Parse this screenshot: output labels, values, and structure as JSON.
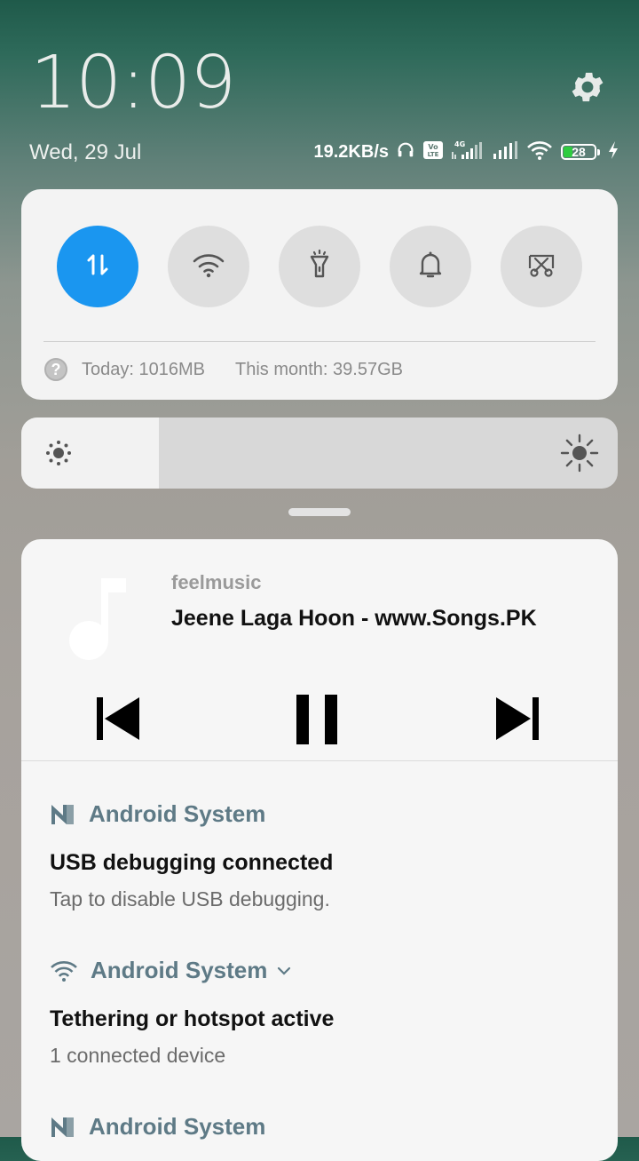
{
  "status": {
    "time": "10:09",
    "date": "Wed, 29 Jul",
    "speed": "19.2KB/s",
    "battery": "28",
    "battery_level": 0.28
  },
  "quick_settings": {
    "toggles": [
      {
        "name": "mobile-data",
        "icon": "data-arrows-icon",
        "active": true
      },
      {
        "name": "wifi",
        "icon": "wifi-icon",
        "active": false
      },
      {
        "name": "flashlight",
        "icon": "flashlight-icon",
        "active": false
      },
      {
        "name": "sound",
        "icon": "bell-icon",
        "active": false
      },
      {
        "name": "screenshot",
        "icon": "scissors-icon",
        "active": false
      }
    ],
    "usage_today": "Today: 1016MB",
    "usage_month": "This month: 39.57GB"
  },
  "brightness": {
    "level": 0.23
  },
  "media": {
    "app": "feelmusic",
    "title": "Jeene Laga Hoon - www.Songs.PK"
  },
  "notifications": [
    {
      "app": "Android System",
      "title": "USB debugging connected",
      "text": "Tap to disable USB debugging."
    },
    {
      "app": "Android System",
      "title": "Tethering or hotspot active",
      "text": "1 connected device"
    },
    {
      "app": "Android System"
    }
  ],
  "colors": {
    "accent": "#1a96f0",
    "app_label": "#5e7a86"
  }
}
